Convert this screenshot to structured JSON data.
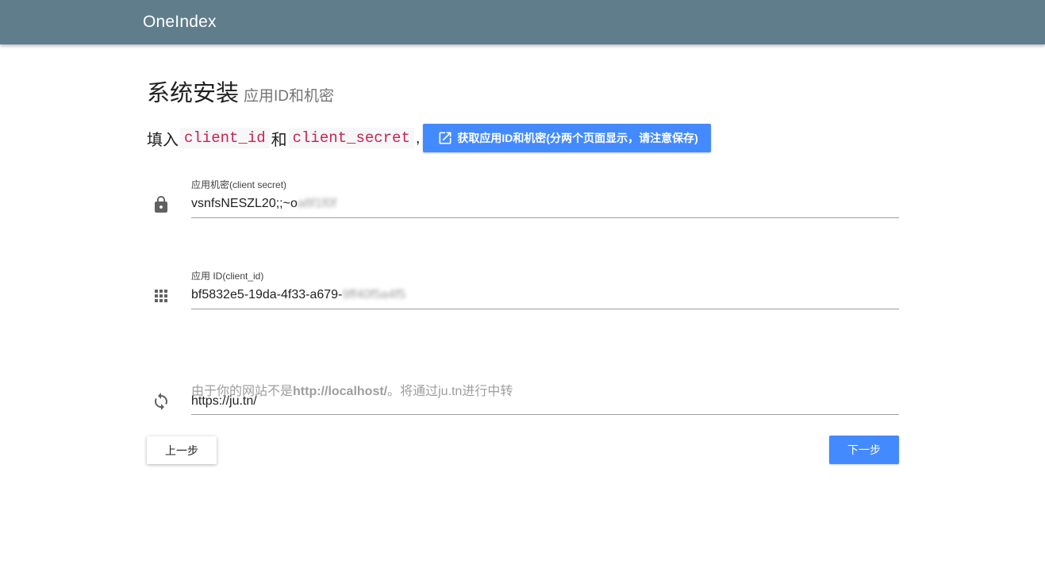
{
  "appbar": {
    "title": "OneIndex"
  },
  "heading": {
    "main": "系统安装",
    "sub": "应用ID和机密"
  },
  "intro": {
    "prefix": "填入",
    "code1": "client_id",
    "middle": "和",
    "code2": "client_secret",
    "suffix": ",",
    "link_button_label": "获取应用ID和机密(分两个页面显示，请注意保存)"
  },
  "fields": {
    "secret": {
      "label": "应用机密(client secret)",
      "value_visible": "vsnfsNESZL20;;~o",
      "value_redacted": "a8f1f0f",
      "icon": "lock-icon"
    },
    "client_id": {
      "label": "应用 ID(client_id)",
      "value_visible": "bf5832e5-19da-4f33-a679-",
      "value_redacted": "9ff40f5a4f5",
      "icon": "apps-grid-icon"
    },
    "redirect": {
      "hint_prefix": "由于你的网站不是",
      "hint_bold": "http://localhost/",
      "hint_suffix": "。将通过ju.tn进行中转",
      "value": "https://ju.tn/",
      "icon": "sync-icon"
    }
  },
  "buttons": {
    "prev": "上一步",
    "next": "下一步"
  },
  "colors": {
    "appbar": "#607d8b",
    "accent": "#448aff",
    "code_text": "#c7254e"
  }
}
